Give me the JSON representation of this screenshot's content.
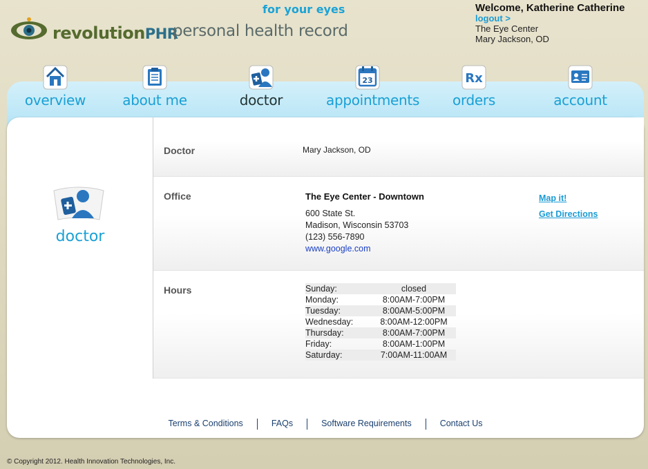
{
  "header": {
    "brand_main": "revolution",
    "brand_phr": "PHR",
    "tagline": "personal health record",
    "slogan": "for your eyes",
    "welcome": "Welcome, Katherine Catherine",
    "logout": "logout >",
    "practice": "The Eye Center",
    "provider": "Mary Jackson, OD"
  },
  "nav": {
    "overview": "overview",
    "about_me": "about me",
    "doctor": "doctor",
    "appointments": "appointments",
    "orders": "orders",
    "account": "account",
    "active": "doctor",
    "calendar_day": "23",
    "rx_glyph": "Rx"
  },
  "sidebar": {
    "title": "doctor"
  },
  "doctor_row": {
    "label": "Doctor",
    "value": "Mary Jackson, OD"
  },
  "office_row": {
    "label": "Office",
    "name": "The Eye Center - Downtown",
    "street": "600 State St.",
    "city": "Madison, Wisconsin 53703",
    "phone": "(123) 556-7890",
    "website": "www.google.com",
    "map_link": "Map it!",
    "directions_link": "Get Directions"
  },
  "hours_row": {
    "label": "Hours",
    "days": [
      {
        "day": "Sunday:",
        "time": "closed"
      },
      {
        "day": "Monday:",
        "time": "8:00AM-7:00PM"
      },
      {
        "day": "Tuesday:",
        "time": "8:00AM-5:00PM"
      },
      {
        "day": "Wednesday:",
        "time": "8:00AM-12:00PM"
      },
      {
        "day": "Thursday:",
        "time": "8:00AM-7:00PM"
      },
      {
        "day": "Friday:",
        "time": "8:00AM-1:00PM"
      },
      {
        "day": "Saturday:",
        "time": "7:00AM-11:00AM"
      }
    ]
  },
  "footer": {
    "terms": "Terms & Conditions",
    "faqs": "FAQs",
    "software": "Software Requirements",
    "contact": "Contact Us"
  },
  "copyright": "© Copyright 2012. Health Innovation Technologies, Inc.",
  "colors": {
    "accent": "#1aa0d5",
    "background": "#e4dfc7",
    "nav_band": "#bde7f7",
    "brand_green": "#556b2f"
  }
}
